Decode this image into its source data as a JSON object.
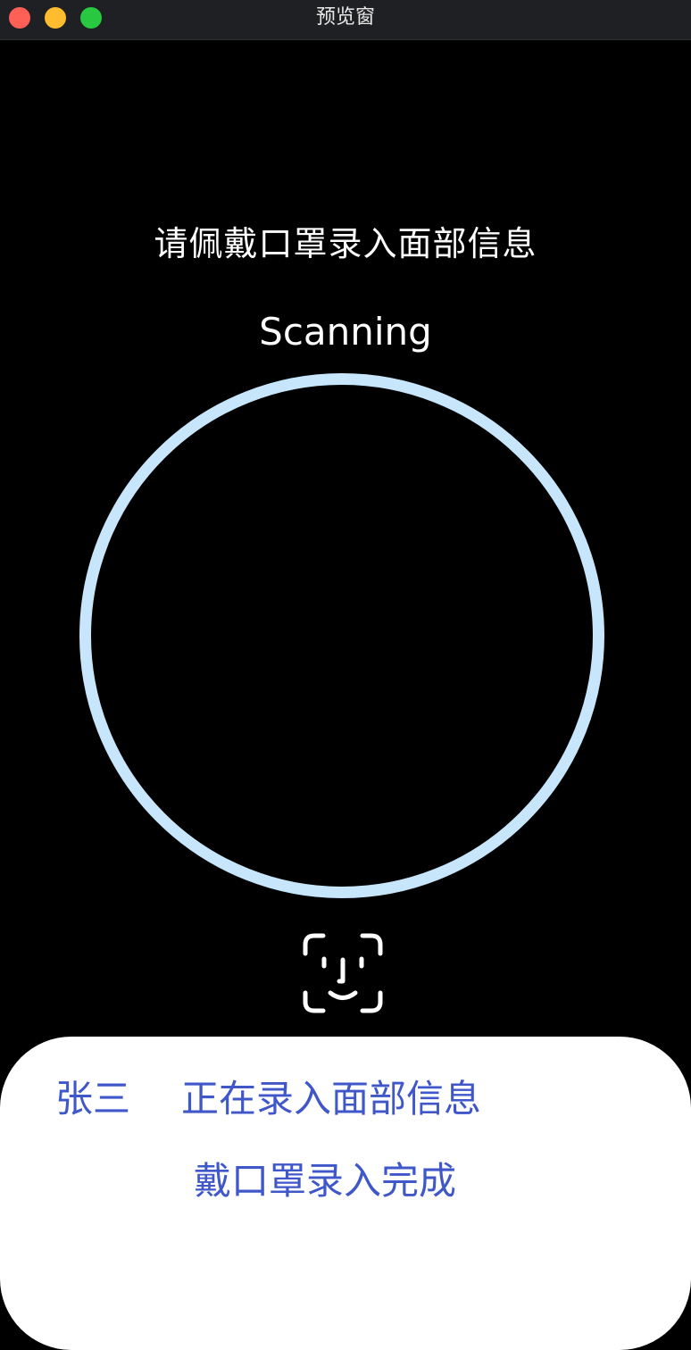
{
  "window": {
    "title": "预览窗"
  },
  "main": {
    "prompt": "请佩戴口罩录入面部信息",
    "status": "Scanning",
    "face_icon": "face-id-icon",
    "ring_color": "#c7e6fb"
  },
  "sheet": {
    "user_name": "张三",
    "status": "正在录入面部信息",
    "result": "戴口罩录入完成",
    "text_color": "#3f57c9"
  }
}
